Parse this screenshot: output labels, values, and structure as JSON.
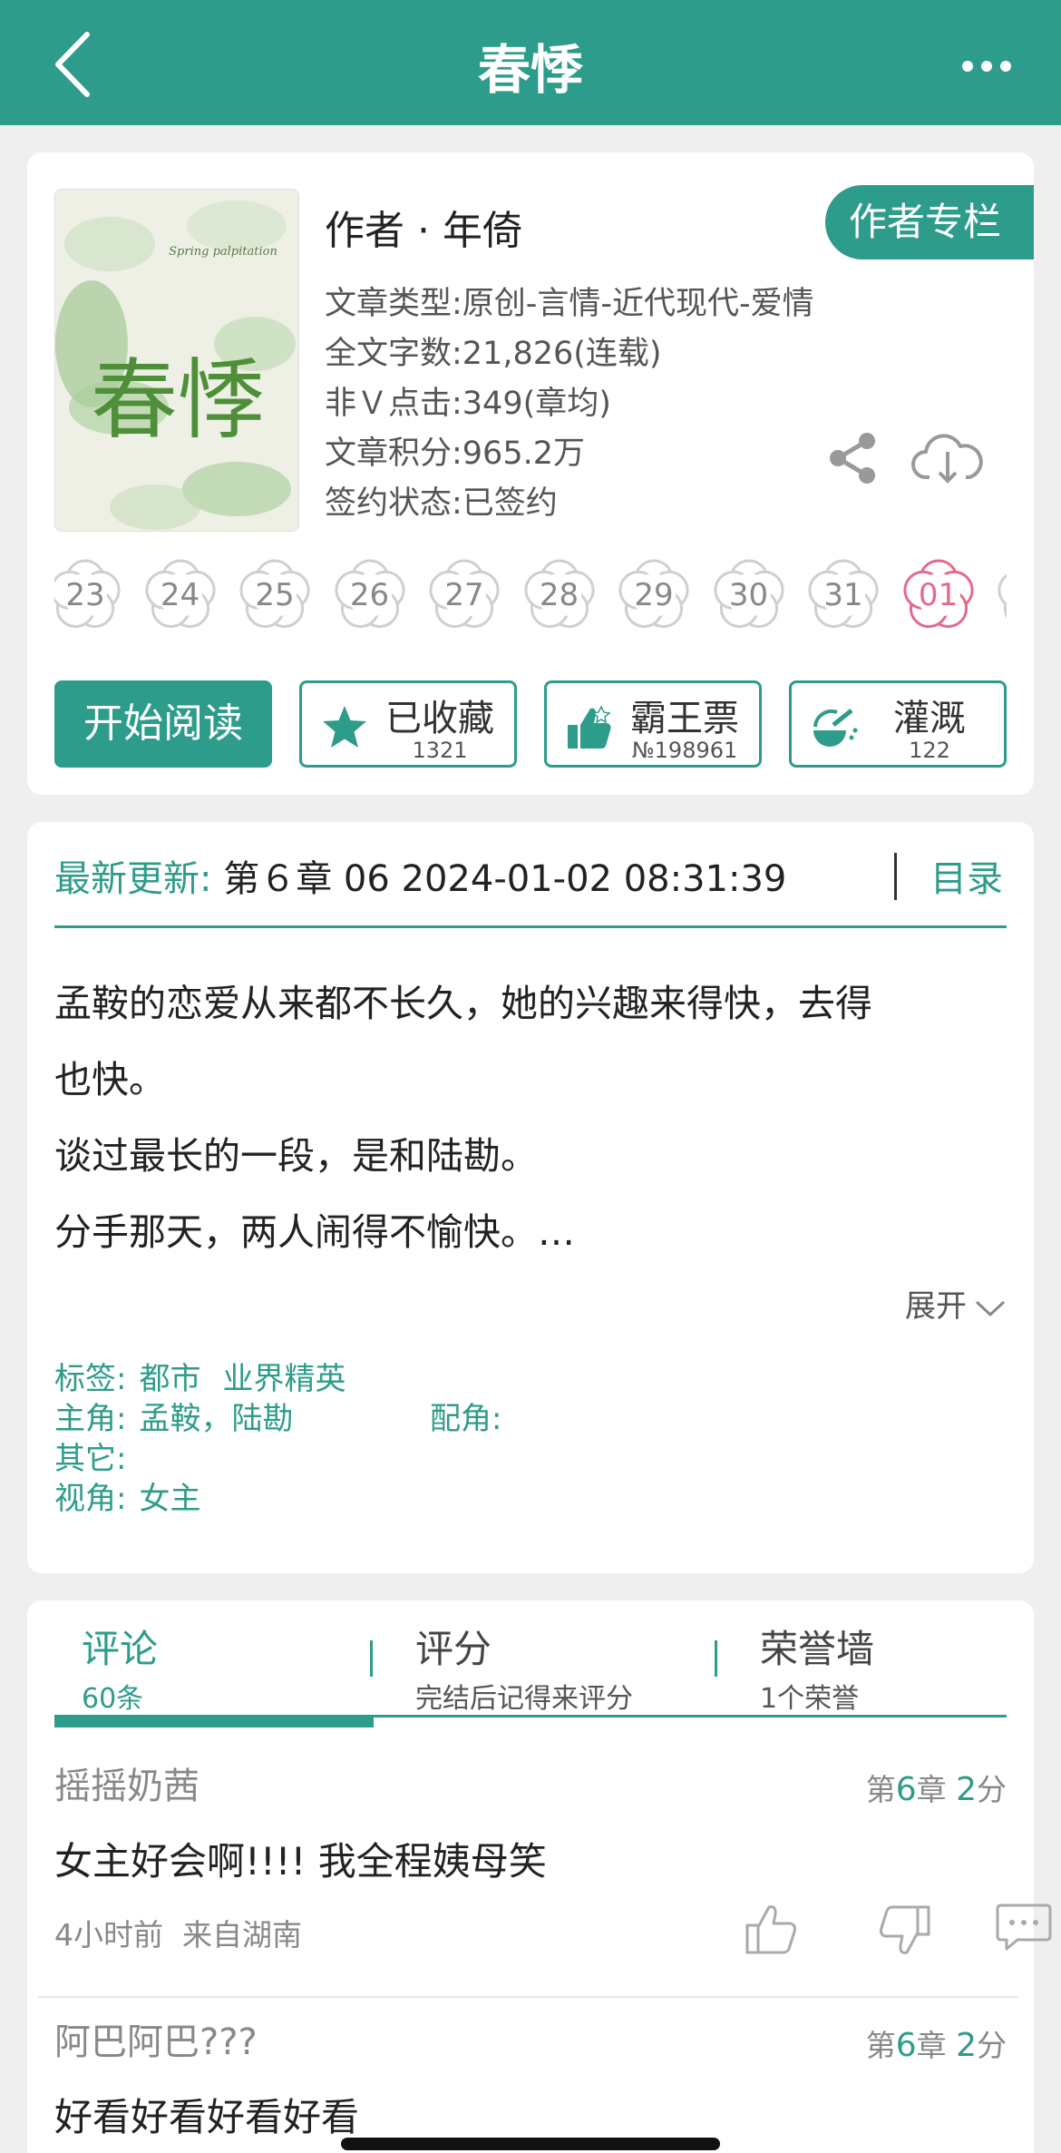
{
  "header": {
    "title": "春悸"
  },
  "book": {
    "cover_en": "Spring palpitation",
    "cover_title": "春悸",
    "author": "作者 · 年倚",
    "author_column_button": "作者专栏",
    "meta": [
      "文章类型:原创-言情-近代现代-爱情",
      "全文字数:21,826(连载)",
      "非Ｖ点击:349(章均)",
      "文章积分:965.2万",
      "签约状态:已签约"
    ]
  },
  "calendar": {
    "days": [
      "23",
      "24",
      "25",
      "26",
      "27",
      "28",
      "29",
      "30",
      "31",
      "01"
    ],
    "active_day": "01"
  },
  "actions": {
    "read": "开始阅读",
    "collect": {
      "label": "已收藏",
      "count": "1321"
    },
    "vote": {
      "label": "霸王票",
      "count": "№198961"
    },
    "water": {
      "label": "灌溉",
      "count": "122"
    }
  },
  "latest": {
    "label": "最新更新:",
    "value": "第６章 06 2024-01-02 08:31:39",
    "toc": "目录"
  },
  "summary": {
    "lines": [
      "孟鞍的恋爱从来都不长久，她的兴趣来得快，去得",
      "也快。",
      "谈过最长的一段，是和陆勘。",
      "分手那天，两人闹得不愉快。…"
    ],
    "expand": "展开"
  },
  "tags": {
    "tags_label": "标签:",
    "tags": [
      "都市",
      "业界精英"
    ],
    "lead_label": "主角:",
    "lead": "孟鞍，陆勘",
    "support_label": "配角:",
    "other_label": "其它:",
    "pov_label": "视角:",
    "pov": "女主"
  },
  "tabs": [
    {
      "title": "评论",
      "sub": "60条"
    },
    {
      "title": "评分",
      "sub": "完结后记得来评分"
    },
    {
      "title": "荣誉墙",
      "sub": "1个荣誉"
    }
  ],
  "comments": [
    {
      "user": "摇摇奶茜",
      "ch_pre": "第",
      "ch": "6",
      "ch_mid": "章 ",
      "score": "2",
      "ch_suf": "分",
      "text": "女主好会啊!!!!  我全程姨母笑",
      "time": "4小时前",
      "place": "来自湖南"
    },
    {
      "user": "阿巴阿巴???",
      "ch_pre": "第",
      "ch": "6",
      "ch_mid": "章 ",
      "score": "2",
      "ch_suf": "分",
      "text": "好看好看好看好看",
      "time": "",
      "place": ""
    }
  ],
  "colors": {
    "accent": "#2e9c8a",
    "pink": "#e46a8c"
  }
}
